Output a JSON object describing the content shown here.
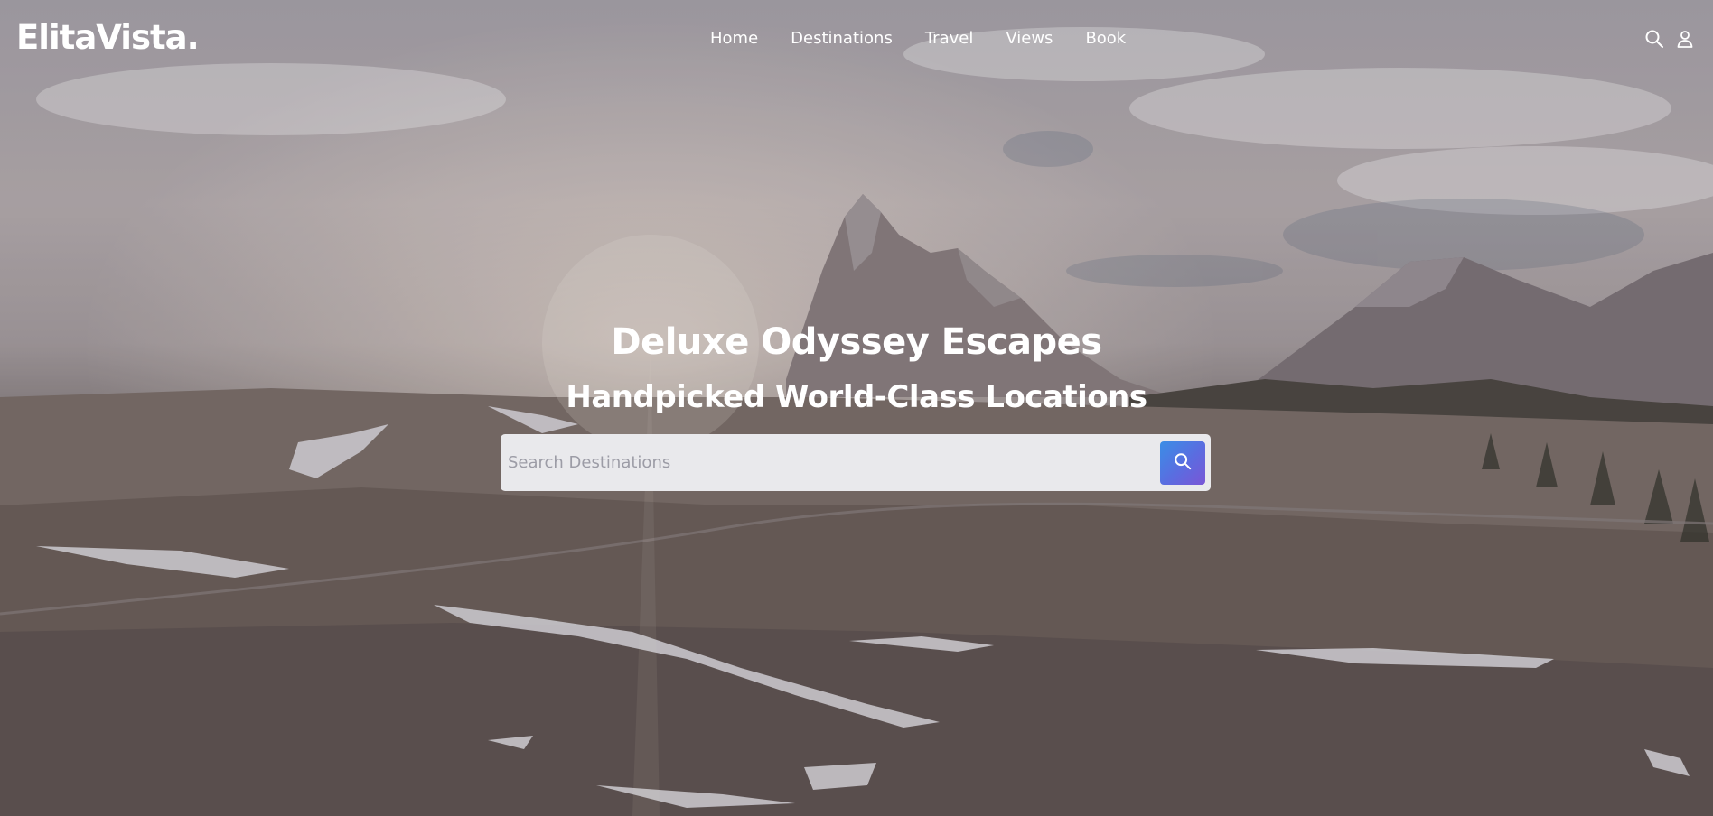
{
  "brand": {
    "logo_text": "ElitaVista."
  },
  "nav": {
    "items": [
      {
        "label": "Home"
      },
      {
        "label": "Destinations"
      },
      {
        "label": "Travel"
      },
      {
        "label": "Views"
      },
      {
        "label": "Book"
      }
    ],
    "icons": [
      "search-icon",
      "user-icon"
    ]
  },
  "hero": {
    "title": "Deluxe Odyssey Escapes",
    "subtitle": "Handpicked World-Class Locations",
    "search": {
      "placeholder": "Search Destinations",
      "value": "",
      "button_icon": "search-icon"
    }
  },
  "colors": {
    "text": "#ffffff",
    "search_field_bg": "#e9e9ec",
    "button_gradient_start": "#3a8ee6",
    "button_gradient_end": "#7a56d6"
  }
}
